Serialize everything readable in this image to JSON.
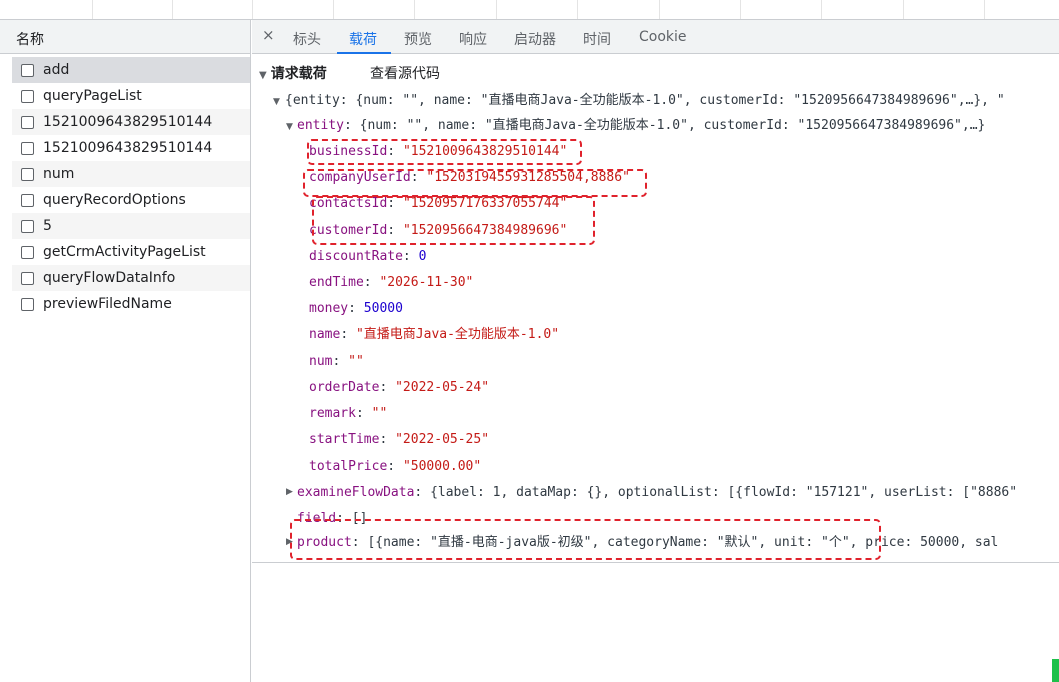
{
  "left_pane": {
    "header": "名称",
    "requests": [
      "add",
      "queryPageList",
      "1521009643829510144",
      "1521009643829510144",
      "num",
      "queryRecordOptions",
      "5",
      "getCrmActivityPageList",
      "queryFlowDataInfo",
      "previewFiledName"
    ],
    "selected_index": 0
  },
  "tabs": {
    "close": "×",
    "items": [
      "标头",
      "载荷",
      "预览",
      "响应",
      "启动器",
      "时间",
      "Cookie"
    ],
    "active": "载荷"
  },
  "payload": {
    "section_title": "请求载荷",
    "view_source": "查看源代码",
    "root_summary": "{entity: {num: \"\", name: \"直播电商Java-全功能版本-1.0\", customerId: \"1520956647384989696\",…}, \"",
    "entity_key": "entity",
    "entity_summary": "{num: \"\", name: \"直播电商Java-全功能版本-1.0\", customerId: \"1520956647384989696\",…}",
    "fields": [
      {
        "key": "businessId",
        "value": "\"1521009643829510144\"",
        "type": "string"
      },
      {
        "key": "companyUserId",
        "value": "\"1520319455931285504,8886\"",
        "type": "string"
      },
      {
        "key": "contactsId",
        "value": "\"1520957176337055744\"",
        "type": "string"
      },
      {
        "key": "customerId",
        "value": "\"1520956647384989696\"",
        "type": "string"
      },
      {
        "key": "discountRate",
        "value": "0",
        "type": "number"
      },
      {
        "key": "endTime",
        "value": "\"2026-11-30\"",
        "type": "string"
      },
      {
        "key": "money",
        "value": "50000",
        "type": "number"
      },
      {
        "key": "name",
        "value": "\"直播电商Java-全功能版本-1.0\"",
        "type": "string"
      },
      {
        "key": "num",
        "value": "\"\"",
        "type": "string"
      },
      {
        "key": "orderDate",
        "value": "\"2022-05-24\"",
        "type": "string"
      },
      {
        "key": "remark",
        "value": "\"\"",
        "type": "string"
      },
      {
        "key": "startTime",
        "value": "\"2022-05-25\"",
        "type": "string"
      },
      {
        "key": "totalPrice",
        "value": "\"50000.00\"",
        "type": "string"
      }
    ],
    "examine_key": "examineFlowData",
    "examine_summary": "{label: 1, dataMap: {}, optionalList: [{flowId: \"157121\", userList: [\"8886\"",
    "field_key": "field",
    "field_value": "[]",
    "product_key": "product",
    "product_summary": "[{name: \"直播-电商-java版-初级\", categoryName: \"默认\", unit: \"个\", price: 50000, sal"
  },
  "colors": {
    "key": "#881280",
    "string": "#c41a16",
    "number": "#1c00cf",
    "annotation": "#e0222c",
    "accent": "#1a73e8"
  },
  "icons": [
    "close-icon",
    "expand-triangle-icon",
    "collapse-triangle-icon",
    "checkbox-icon"
  ]
}
